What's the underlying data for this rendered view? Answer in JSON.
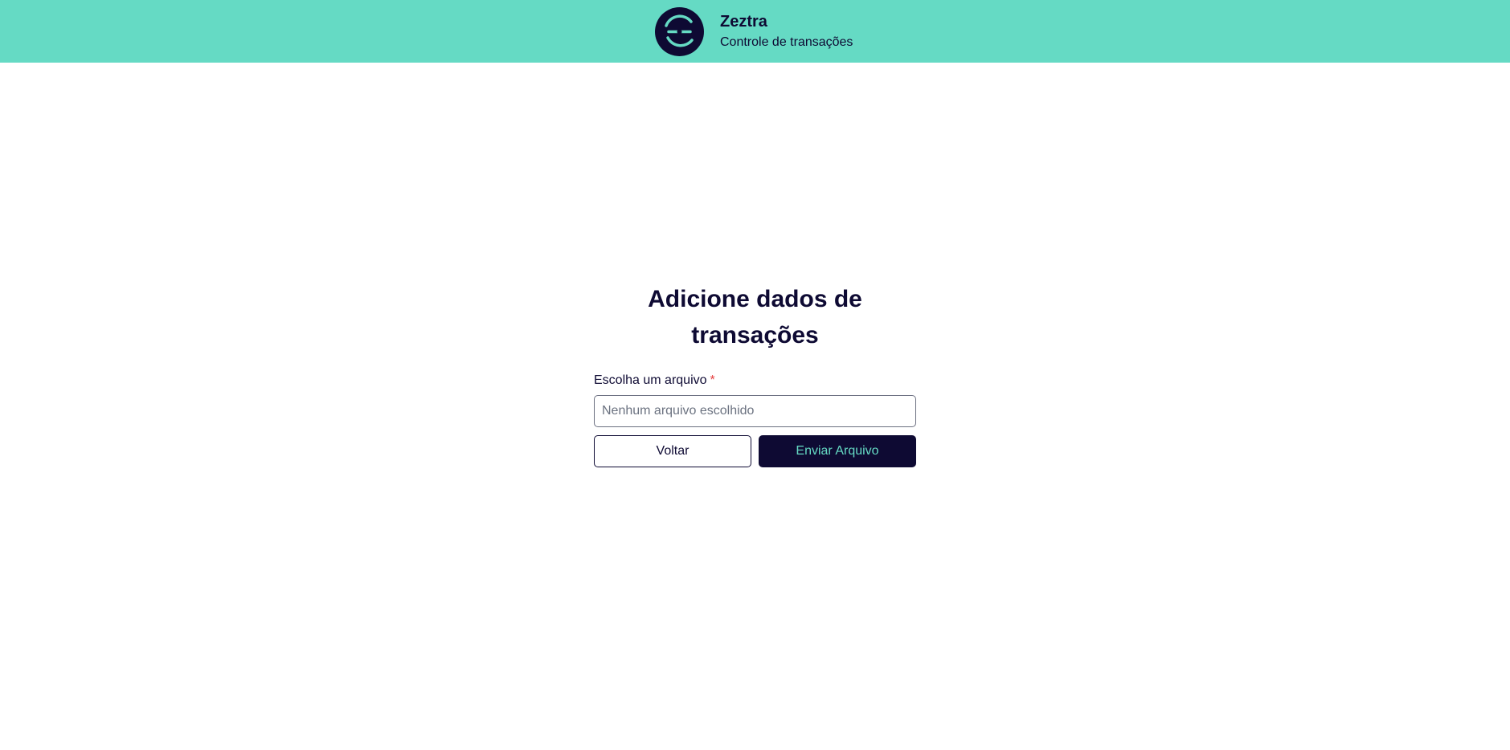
{
  "header": {
    "app_name": "Zeztra",
    "subtitle": "Controle de transações",
    "logo_icon": "zeztra-logo-icon"
  },
  "main": {
    "title": "Adicione dados de transações",
    "file_field": {
      "label": "Escolha um arquivo",
      "required_marker": "*",
      "placeholder": "Nenhum arquivo escolhido"
    },
    "buttons": {
      "back_label": "Voltar",
      "submit_label": "Enviar Arquivo"
    }
  },
  "colors": {
    "header_background": "#65dac4",
    "primary_dark": "#0e0a33",
    "accent": "#65dac4",
    "required": "#e53e3e"
  }
}
